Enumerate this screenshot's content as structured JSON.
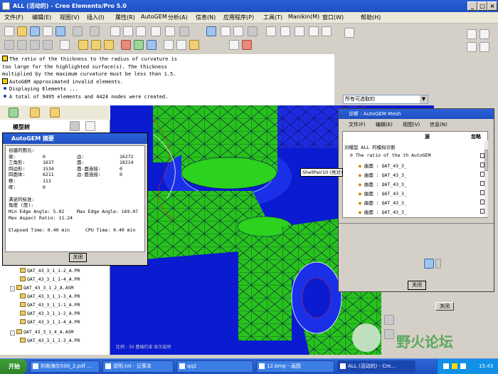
{
  "window": {
    "title": "ALL (活动的) - Creo Elements/Pro 5.0",
    "btn_min": "_",
    "btn_max": "□",
    "btn_close": "×"
  },
  "menubar": [
    "文件(F)",
    "编辑(E)",
    "视图(V)",
    "插入(I)",
    "属性(R)",
    "AutoGEM",
    "分析(A)",
    "信息(N)",
    "应用程序(P)",
    "工具(T)",
    "Manikin(M)",
    "窗口(W)",
    "帮助(H)"
  ],
  "messages": [
    {
      "type": "warning",
      "text": "The ratio of the thickness to the radius of curvature is"
    },
    {
      "type": "text",
      "text": "too large for the highlighted surface(s).  The thickness"
    },
    {
      "type": "text",
      "text": "multiplied by the maximum curvature must be less than 1.5."
    },
    {
      "type": "warning",
      "text": "AutoGEM approximated invalid elements."
    },
    {
      "type": "info",
      "text": "Displaying Elements ..."
    },
    {
      "type": "info",
      "text": "A total of 9495 elements and 4424 nodes were created."
    }
  ],
  "filter_select": {
    "value": "所有可选取的"
  },
  "model_tree": {
    "header": "模型树",
    "items": [
      {
        "label": "QAT_43_3_1_1-2_A.PR",
        "level": 2
      },
      {
        "label": "QAT_43_3_1_1-4_A.PR",
        "level": 2
      },
      {
        "label": "QAT_43_3_1_2_A.ASM",
        "level": 1
      },
      {
        "label": "QAT_43_3_1_1-3_A.PR",
        "level": 2
      },
      {
        "label": "QAT_43_3_1_1-1_A.PR",
        "level": 2
      },
      {
        "label": "QAT_43_3_1_1-2_A.PR",
        "level": 2
      },
      {
        "label": "QAT_43_3_1_1-4_A.PR",
        "level": 2
      },
      {
        "label": "QAT_43_3_1_4_A.ASM",
        "level": 1
      },
      {
        "label": "QAT_43_3_1_1-3_A.PR",
        "level": 2
      }
    ]
  },
  "autogem_summary": {
    "title": "AutoGEM 摘要",
    "created_header": "创建的图元:",
    "left_stats": [
      {
        "label": "梁:",
        "value": "0"
      },
      {
        "label": "三角形:",
        "value": "1637"
      },
      {
        "label": "四边形:",
        "value": "1534"
      },
      {
        "label": "四面体:",
        "value": "6211"
      },
      {
        "label": "楔:",
        "value": "113"
      },
      {
        "label": "砖:",
        "value": "0"
      }
    ],
    "right_stats": [
      {
        "label": "边:",
        "value": "16272"
      },
      {
        "label": "面:",
        "value": "18214"
      },
      {
        "label": "面-面连接:",
        "value": "0"
      },
      {
        "label": "边-面连接:",
        "value": "0"
      }
    ],
    "criteria_header": "满足的标准:",
    "angle_header": "角度 (度):",
    "min_edge_angle": "Min Edge Angle:  5.02",
    "max_edge_angle": "Max Edge Angle: 169.07",
    "max_aspect_ratio": "Max Aspect Ratio: 11.24",
    "elapsed_time": "Elapsed Time:  0.40 min",
    "cpu_time": "CPU Time:  0.40 min",
    "close_label": "关闭"
  },
  "diagnostics": {
    "title": "诊断 : AutoGEM Mesh",
    "menu": [
      "文件(F)",
      "编辑(E)",
      "视图(V)",
      "信息(N)"
    ],
    "col_source": "源",
    "col_ignore": "忽略",
    "root": "对模型 ALL 的模拟诊断",
    "group": "The ratio of the th AutoGEM",
    "items": [
      "曲面 : QAT_43_3_",
      "曲面 : QAT_43_3_",
      "曲面 : QAT_43_3_",
      "曲面 : QAT_43_3_",
      "曲面 : QAT_43_3_",
      "曲面 : QAT_43_3_",
      "曲面 : QAT_43_3_"
    ],
    "close_label": "关闭"
  },
  "tooltip": {
    "label": "ShellPair10 (亮对)"
  },
  "secondary_close": "关闭",
  "viewport_status": "比例 : 30    基础约束   显示选项",
  "taskbar": {
    "start": "开始",
    "tasks": [
      "利勃海尔500_2.pdf ...",
      "说明.txt - 记事本",
      "qq2",
      "12.bmp - 画图",
      "ALL (活动的) - Cre..."
    ],
    "clock": "15:43"
  },
  "watermark": "野火论坛",
  "colors": {
    "title_blue": "#1f4fc0",
    "mesh_green": "#27c21a",
    "mesh_blue": "#0a1bd0",
    "taskbar_blue": "#2458cf"
  }
}
